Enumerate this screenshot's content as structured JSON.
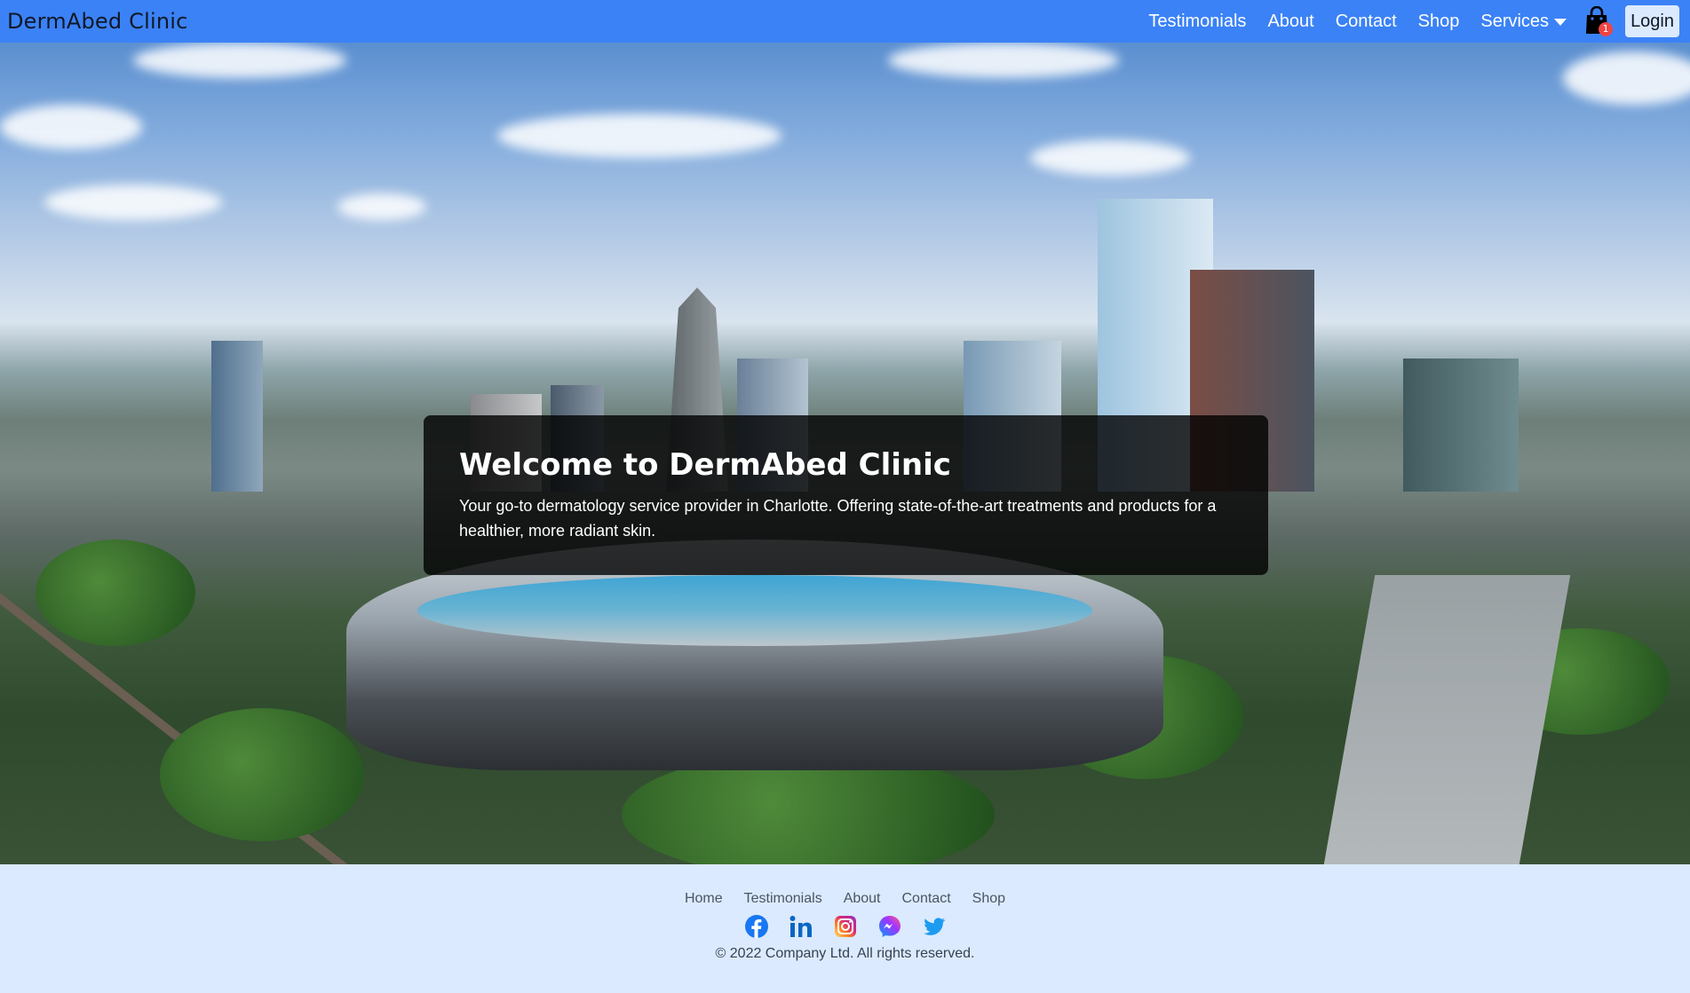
{
  "navbar": {
    "brand": "DermAbed Clinic",
    "links": [
      "Testimonials",
      "About",
      "Contact",
      "Shop"
    ],
    "services_label": "Services",
    "cart_count": "1",
    "login_label": "Login"
  },
  "hero": {
    "title": "Welcome to DermAbed Clinic",
    "text": "Your go-to dermatology service provider in Charlotte. Offering state-of-the-art treatments and products for a healthier, more radiant skin."
  },
  "footer": {
    "links": [
      "Home",
      "Testimonials",
      "About",
      "Contact",
      "Shop"
    ],
    "social_icons": [
      "facebook-icon",
      "linkedin-icon",
      "instagram-icon",
      "messenger-icon",
      "twitter-icon"
    ],
    "copyright": "© 2022 Company Ltd. All rights reserved."
  },
  "colors": {
    "navbar_bg": "#3b82f6",
    "footer_bg": "#dbeafe",
    "login_bg": "#dbeafe",
    "badge": "#ef4444"
  }
}
